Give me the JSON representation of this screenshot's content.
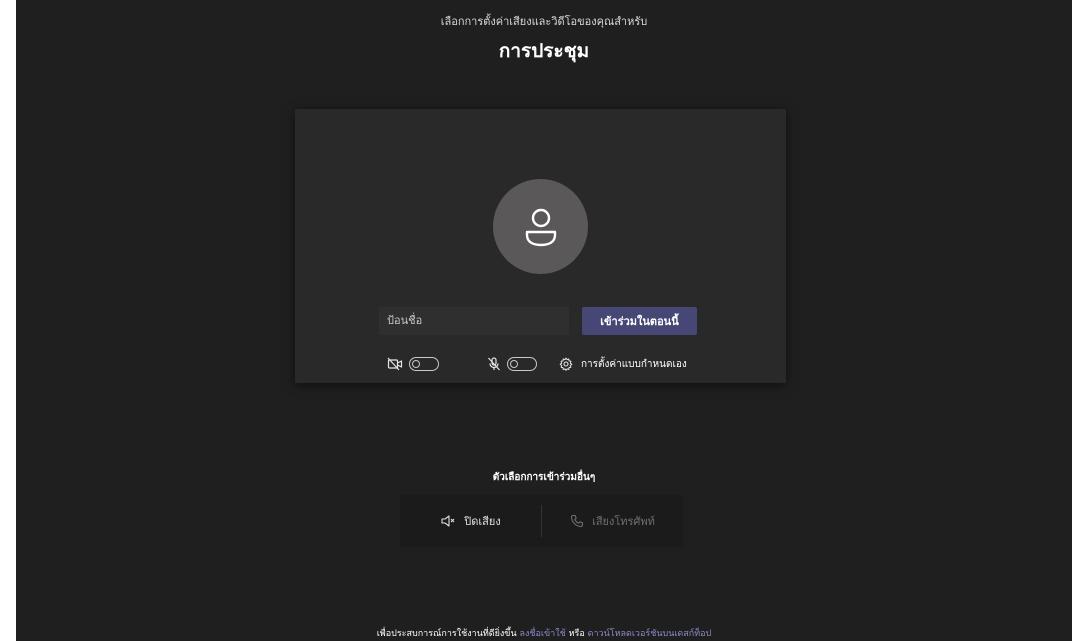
{
  "header": {
    "subtitle": "เลือกการตั้งค่าเสียงและวิดีโอของคุณสำหรับ",
    "title": "การประชุม"
  },
  "prejoin": {
    "name_placeholder": "ป้อนชื่อ",
    "join_label": "เข้าร่วมในตอนนี้",
    "camera_toggle": "off",
    "mic_toggle": "off",
    "settings_label": "การตั้งค่าแบบกำหนดเอง"
  },
  "other_options": {
    "title": "ตัวเลือกการเข้าร่วมอื่นๆ",
    "mute_label": "ปิดเสียง",
    "phone_label": "เสียงโทรศัพท์"
  },
  "footer": {
    "prefix": "เพื่อประสบการณ์การใช้งานที่ดียิ่งขึ้น",
    "signin_link": "ลงชื่อเข้าใช้",
    "or": "หรือ",
    "download_link": "ดาวน์โหลดเวอร์ชันบนเดสก์ท็อป"
  },
  "colors": {
    "background": "#1f1f1f",
    "card": "#292929",
    "accent": "#464775",
    "link": "#8b8cc7"
  }
}
